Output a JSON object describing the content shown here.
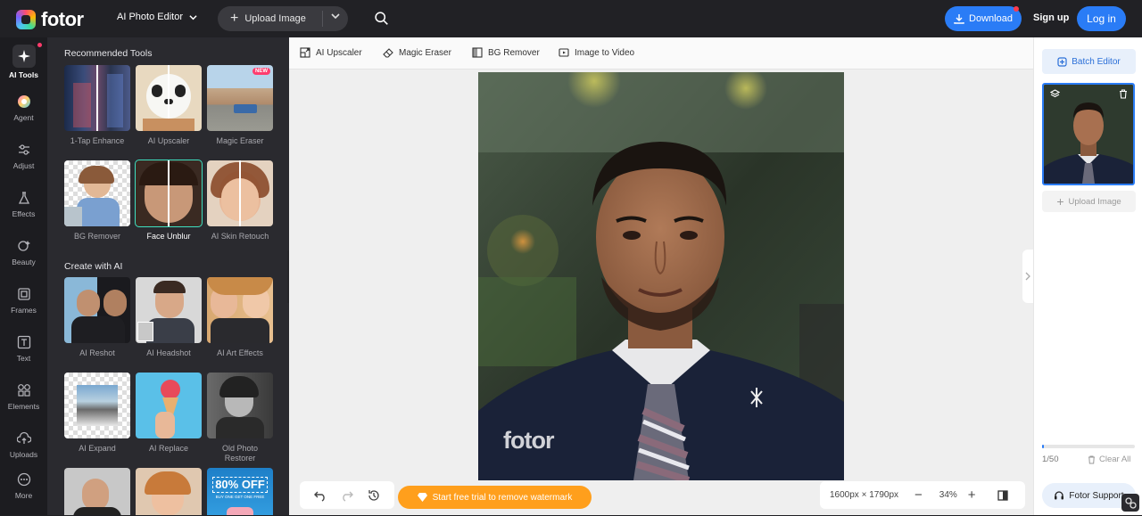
{
  "header": {
    "logo_text": "fotor",
    "editor_menu": "AI Photo Editor",
    "upload_button": "Upload Image",
    "download_button": "Download",
    "signup": "Sign up",
    "login": "Log in"
  },
  "leftnav": {
    "items": [
      {
        "label": "AI Tools",
        "icon": "sparkle-icon"
      },
      {
        "label": "Agent",
        "icon": "agent-icon"
      },
      {
        "label": "Adjust",
        "icon": "sliders-icon"
      },
      {
        "label": "Effects",
        "icon": "flask-icon"
      },
      {
        "label": "Beauty",
        "icon": "beauty-icon"
      },
      {
        "label": "Frames",
        "icon": "frame-icon"
      },
      {
        "label": "Text",
        "icon": "text-icon"
      },
      {
        "label": "Elements",
        "icon": "elements-icon"
      },
      {
        "label": "Uploads",
        "icon": "cloud-upload-icon"
      },
      {
        "label": "More",
        "icon": "more-icon"
      }
    ]
  },
  "toolpanel": {
    "recommended_title": "Recommended Tools",
    "recommended": [
      {
        "label": "1-Tap Enhance"
      },
      {
        "label": "AI Upscaler"
      },
      {
        "label": "Magic Eraser",
        "badge": "NEW"
      },
      {
        "label": "BG Remover"
      },
      {
        "label": "Face Unblur"
      },
      {
        "label": "AI Skin Retouch"
      }
    ],
    "create_title": "Create with AI",
    "create": [
      {
        "label": "AI Reshot"
      },
      {
        "label": "AI Headshot"
      },
      {
        "label": "AI Art Effects"
      },
      {
        "label": "AI Expand"
      },
      {
        "label": "AI Replace"
      },
      {
        "label": "Old Photo Restorer"
      }
    ],
    "promo_text": "80% OFF",
    "promo_sub": "BUY ONE GET ONE FREE"
  },
  "subbar": {
    "tools": [
      "AI Upscaler",
      "Magic Eraser",
      "BG Remover",
      "Image to Video"
    ]
  },
  "canvas": {
    "watermark": "fotor",
    "trial_button": "Start free trial to remove watermark",
    "dimensions": "1600px × 1790px",
    "zoom": "34%"
  },
  "rightpanel": {
    "batch_editor": "Batch Editor",
    "upload_image": "Upload Image",
    "count": "1/50",
    "clear_all": "Clear All",
    "support": "Fotor Support",
    "progress": 0.02
  }
}
